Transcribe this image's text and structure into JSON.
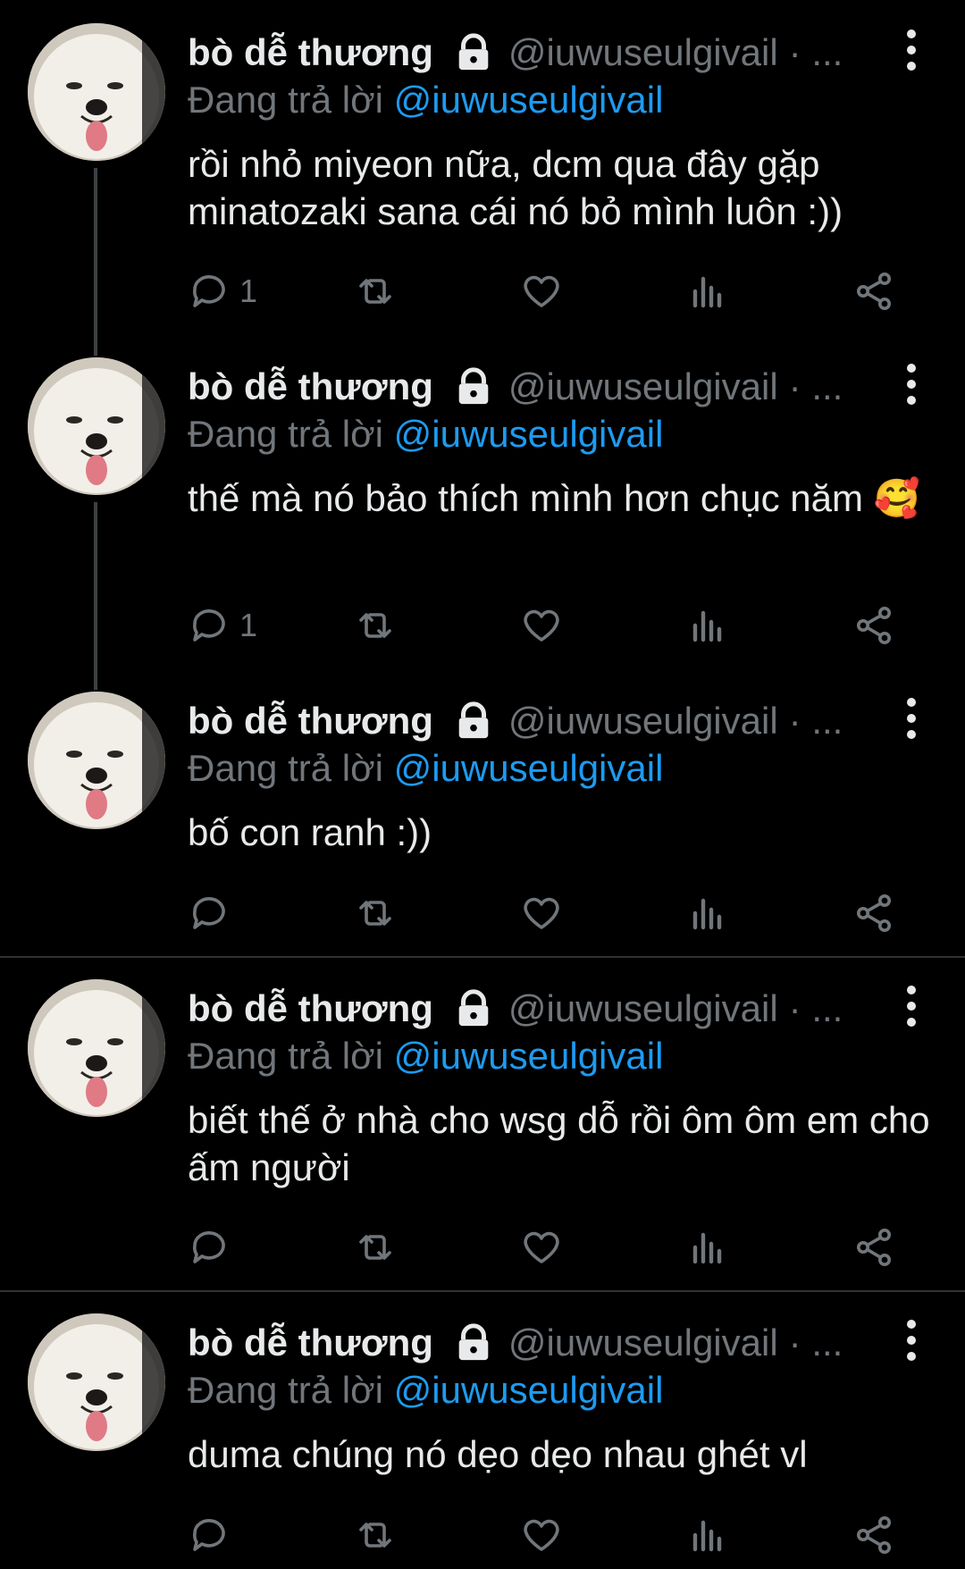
{
  "colors": {
    "background": "#000000",
    "text": "#e7e9ea",
    "muted": "#71767b",
    "accent": "#1d9bf0",
    "divider": "#2f3336"
  },
  "tweets": [
    {
      "display_name": "bò dễ thương",
      "handle": "@iuwuseulgivail",
      "separator": "· ...",
      "replying_prefix": "Đang trả lời",
      "replying_to": "@iuwuseulgivail",
      "text": "rồi nhỏ miyeon nữa, dcm qua đây gặp minatozaki sana cái nó bỏ mình luôn :))",
      "reply_count": "1"
    },
    {
      "display_name": "bò dễ thương",
      "handle": "@iuwuseulgivail",
      "separator": "· ...",
      "replying_prefix": "Đang trả lời",
      "replying_to": "@iuwuseulgivail",
      "text": "thế mà nó bảo thích mình hơn chục năm 🥰",
      "reply_count": "1"
    },
    {
      "display_name": "bò dễ thương",
      "handle": "@iuwuseulgivail",
      "separator": "· ...",
      "replying_prefix": "Đang trả lời",
      "replying_to": "@iuwuseulgivail",
      "text": "bố con ranh :))",
      "reply_count": ""
    },
    {
      "display_name": "bò dễ thương",
      "handle": "@iuwuseulgivail",
      "separator": "· ...",
      "replying_prefix": "Đang trả lời",
      "replying_to": "@iuwuseulgivail",
      "text": "biết thế ở nhà cho wsg dỗ rồi ôm ôm em cho ấm người",
      "reply_count": ""
    },
    {
      "display_name": "bò dễ thương",
      "handle": "@iuwuseulgivail",
      "separator": "· ...",
      "replying_prefix": "Đang trả lời",
      "replying_to": "@iuwuseulgivail",
      "text": "duma chúng nó dẹo dẹo nhau ghét vl",
      "reply_count": ""
    }
  ],
  "icons": [
    "avatar-samoyed",
    "lock-icon",
    "more-vertical-icon",
    "reply-icon",
    "retweet-icon",
    "like-icon",
    "views-icon",
    "share-icon"
  ]
}
